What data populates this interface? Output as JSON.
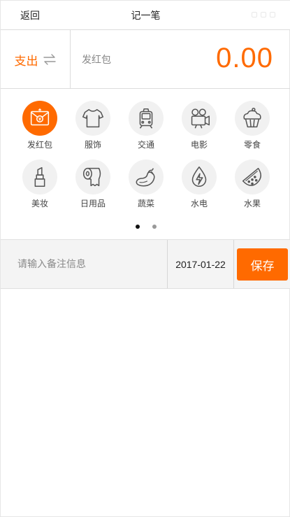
{
  "nav": {
    "back_label": "返回",
    "title": "记一笔"
  },
  "entry": {
    "type_label": "支出",
    "category_name": "发红包",
    "amount": "0.00"
  },
  "categories": [
    {
      "label": "发红包",
      "icon": "red-packet-icon",
      "active": true
    },
    {
      "label": "服饰",
      "icon": "tshirt-icon"
    },
    {
      "label": "交通",
      "icon": "tram-icon"
    },
    {
      "label": "电影",
      "icon": "movie-camera-icon"
    },
    {
      "label": "零食",
      "icon": "cupcake-icon"
    },
    {
      "label": "美妆",
      "icon": "lipstick-icon"
    },
    {
      "label": "日用品",
      "icon": "toilet-paper-icon"
    },
    {
      "label": "蔬菜",
      "icon": "eggplant-icon"
    },
    {
      "label": "水电",
      "icon": "water-power-icon"
    },
    {
      "label": "水果",
      "icon": "watermelon-icon"
    }
  ],
  "pager": {
    "pages": 2,
    "current": 1
  },
  "note": {
    "placeholder": "请输入备注信息",
    "value": ""
  },
  "date": "2017-01-22",
  "save_label": "保存",
  "colors": {
    "accent": "#ff6a00",
    "icon_bg": "#f1f1f1",
    "input_bg": "#f4f4f4"
  }
}
